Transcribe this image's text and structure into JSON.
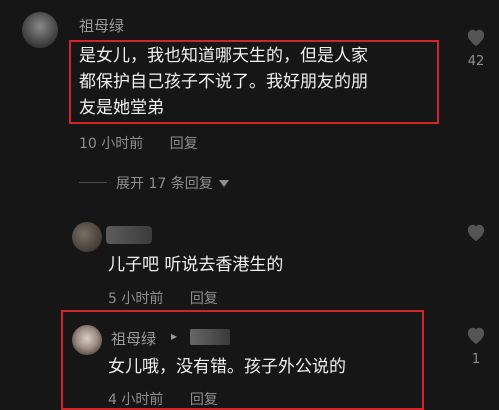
{
  "comment1": {
    "username": "祖母绿",
    "lines": [
      "是女儿，我也知道哪天生的，但是人家",
      "都保护自己孩子不说了。我好朋友的朋",
      "友是她堂弟"
    ],
    "time": "10 小时前",
    "reply_label": "回复",
    "likes": "42"
  },
  "expand": {
    "label": "展开 17 条回复"
  },
  "reply1": {
    "text": "儿子吧 听说去香港生的",
    "time": "5 小时前",
    "reply_label": "回复"
  },
  "reply2": {
    "username": "祖母绿",
    "arrow": "▸",
    "text": "女儿哦，没有错。孩子外公说的",
    "time": "4 小时前",
    "reply_label": "回复",
    "likes": "1"
  },
  "colors": {
    "highlight": "#d4242b",
    "background": "#161616"
  },
  "icons": [
    "heart-icon",
    "chevron-down-icon"
  ]
}
